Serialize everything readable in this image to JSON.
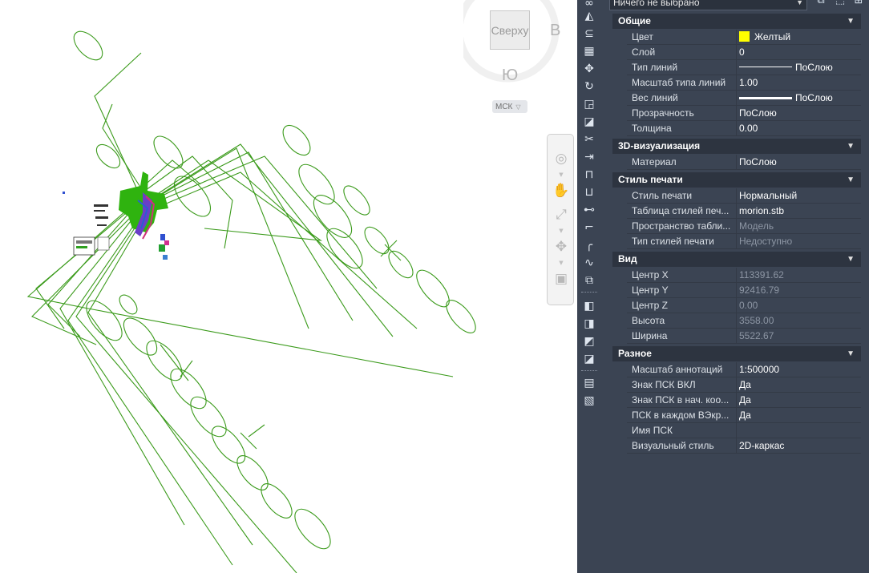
{
  "viewcube": {
    "face": "Сверху",
    "east": "В",
    "south": "Ю",
    "ucs_menu": "МСК"
  },
  "selection": {
    "value": "Ничего не выбрано"
  },
  "sections": {
    "general": {
      "title": "Общие",
      "props": [
        {
          "label": "Цвет",
          "value": "Желтый"
        },
        {
          "label": "Слой",
          "value": "0"
        },
        {
          "label": "Тип линий",
          "value": "ПоСлою"
        },
        {
          "label": "Масштаб типа линий",
          "value": "1.00"
        },
        {
          "label": "Вес линий",
          "value": "ПоСлою"
        },
        {
          "label": "Прозрачность",
          "value": "ПоСлою"
        },
        {
          "label": "Толщина",
          "value": "0.00"
        }
      ]
    },
    "vis3d": {
      "title": "3D-визуализация",
      "props": [
        {
          "label": "Материал",
          "value": "ПоСлою"
        }
      ]
    },
    "plot": {
      "title": "Стиль печати",
      "props": [
        {
          "label": "Стиль печати",
          "value": "Нормальный"
        },
        {
          "label": "Таблица стилей печ...",
          "value": "morion.stb"
        },
        {
          "label": "Пространство табли...",
          "value": "Модель"
        },
        {
          "label": "Тип стилей печати",
          "value": "Недоступно"
        }
      ]
    },
    "view": {
      "title": "Вид",
      "props": [
        {
          "label": "Центр X",
          "value": "113391.62"
        },
        {
          "label": "Центр Y",
          "value": "92416.79"
        },
        {
          "label": "Центр Z",
          "value": "0.00"
        },
        {
          "label": "Высота",
          "value": "3558.00"
        },
        {
          "label": "Ширина",
          "value": "5522.67"
        }
      ]
    },
    "misc": {
      "title": "Разное",
      "props": [
        {
          "label": "Масштаб аннотаций",
          "value": "1:500000"
        },
        {
          "label": "Знак ПСК ВКЛ",
          "value": "Да"
        },
        {
          "label": "Знак ПСК в нач. коо...",
          "value": "Да"
        },
        {
          "label": "ПСК в каждом ВЭкр...",
          "value": "Да"
        },
        {
          "label": "Имя ПСК",
          "value": ""
        },
        {
          "label": "Визуальный стиль",
          "value": "2D-каркас"
        }
      ]
    }
  },
  "colors": {
    "drawing": "#3a9a1a",
    "swatch": "#ffff00",
    "panel_bg": "#3b4453"
  }
}
